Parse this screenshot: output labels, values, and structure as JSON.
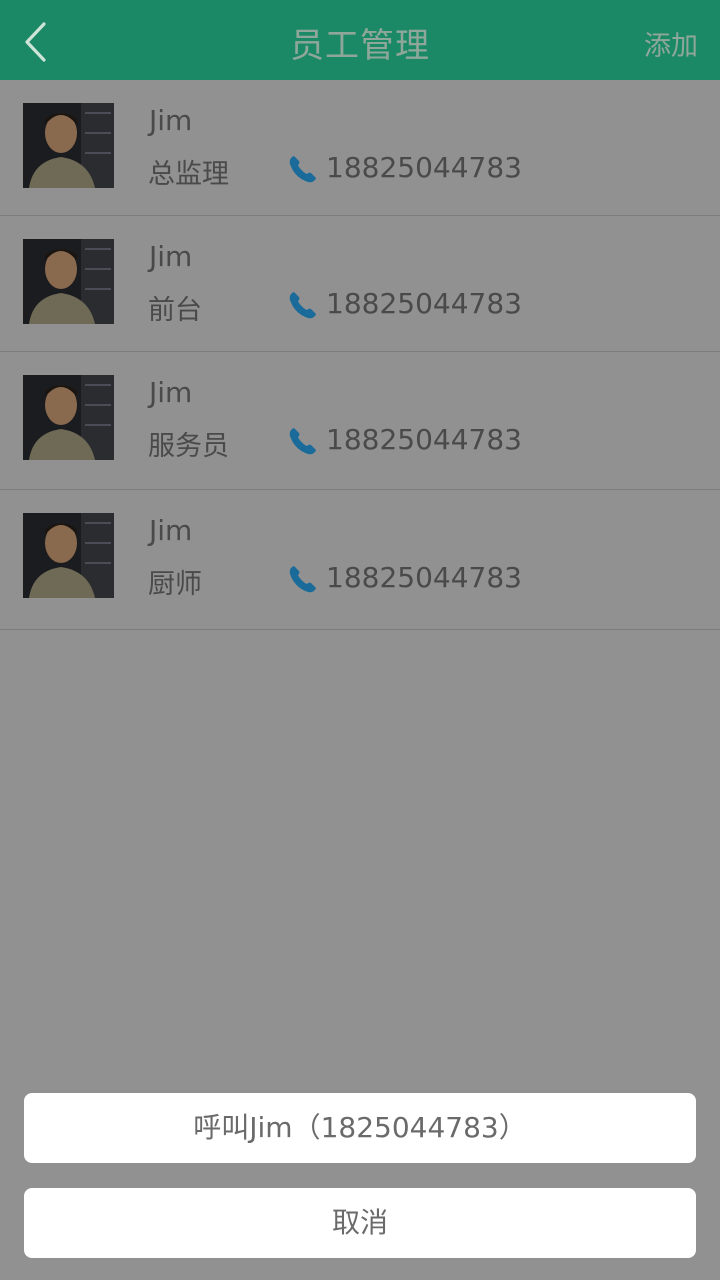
{
  "header": {
    "title": "员工管理",
    "add_label": "添加",
    "bg_color": "#1c8966"
  },
  "employees": [
    {
      "name": "Jim",
      "role": "总监理",
      "phone": "18825044783"
    },
    {
      "name": "Jim",
      "role": "前台",
      "phone": "18825044783"
    },
    {
      "name": "Jim",
      "role": "服务员",
      "phone": "18825044783"
    },
    {
      "name": "Jim",
      "role": "厨师",
      "phone": "18825044783"
    }
  ],
  "action_sheet": {
    "call_label": "呼叫Jim（1825044783）",
    "cancel_label": "取消"
  },
  "icons": {
    "back": "chevron-left-icon",
    "phone": "phone-icon",
    "avatar": "avatar-photo"
  }
}
